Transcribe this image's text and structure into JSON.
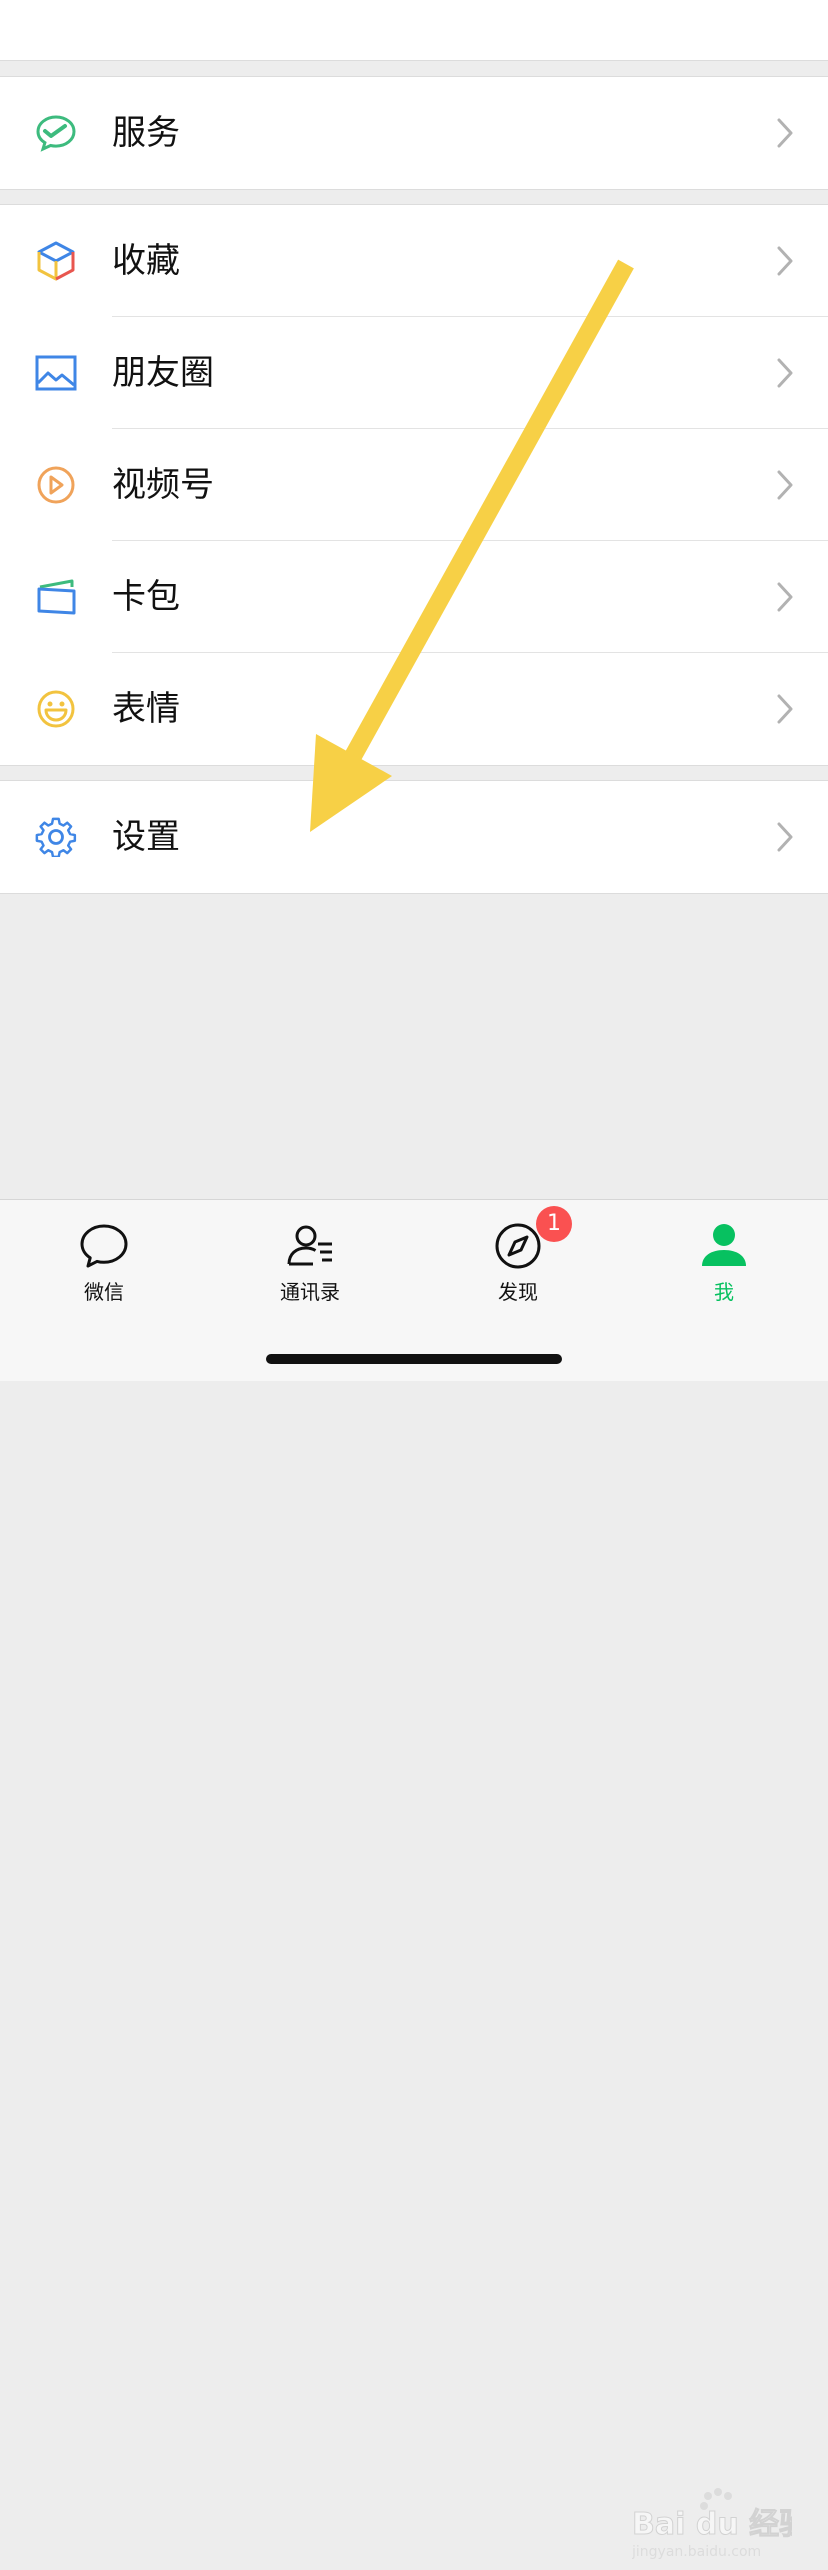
{
  "menu": {
    "services": {
      "label": "服务",
      "icon": "services-icon"
    },
    "favorites": {
      "label": "收藏",
      "icon": "cube-icon"
    },
    "moments": {
      "label": "朋友圈",
      "icon": "image-icon"
    },
    "channels": {
      "label": "视频号",
      "icon": "play-circle-icon"
    },
    "cards": {
      "label": "卡包",
      "icon": "wallet-icon"
    },
    "stickers": {
      "label": "表情",
      "icon": "smile-icon"
    },
    "settings": {
      "label": "设置",
      "icon": "gear-icon"
    }
  },
  "tabbar": {
    "chats": {
      "label": "微信"
    },
    "contacts": {
      "label": "通讯录"
    },
    "discover": {
      "label": "发现",
      "badge": "1"
    },
    "me": {
      "label": "我"
    }
  },
  "watermark": {
    "brand": "Bai du 经验",
    "url": "jingyan.baidu.com"
  },
  "colors": {
    "accent": "#07c160",
    "badge": "#fa5151",
    "annotation_arrow": "#f7d046"
  }
}
